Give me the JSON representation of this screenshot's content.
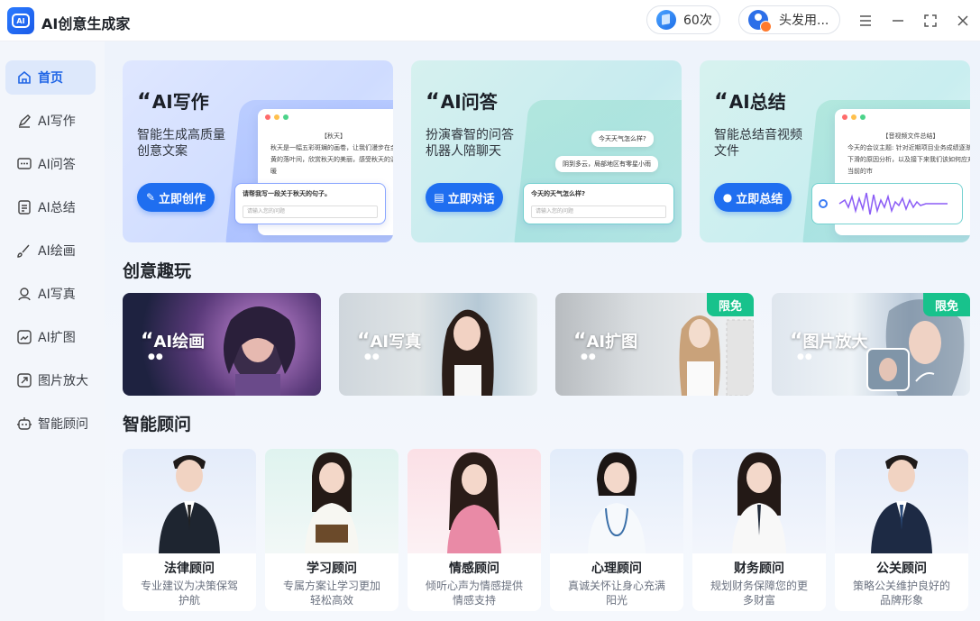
{
  "app": {
    "title": "AI创意生成家",
    "logo_text": "AI"
  },
  "header": {
    "credits": "60次",
    "user_name": "头发用..."
  },
  "sidebar": {
    "items": [
      {
        "label": "首页",
        "icon": "home-icon"
      },
      {
        "label": "AI写作",
        "icon": "pen-icon"
      },
      {
        "label": "AI问答",
        "icon": "chat-icon"
      },
      {
        "label": "AI总结",
        "icon": "document-icon"
      },
      {
        "label": "AI绘画",
        "icon": "brush-icon"
      },
      {
        "label": "AI写真",
        "icon": "portrait-icon"
      },
      {
        "label": "AI扩图",
        "icon": "expand-image-icon"
      },
      {
        "label": "图片放大",
        "icon": "enlarge-icon"
      },
      {
        "label": "智能顾问",
        "icon": "robot-icon"
      }
    ]
  },
  "features": [
    {
      "title": "AI写作",
      "desc": "智能生成高质量创意文案",
      "button": "立即创作",
      "mock_head": "【秋天】",
      "mock_text": "秋天是一幅五彩斑斓的画卷，让我们漫步在金黄的落叶间，欣赏秋天的美丽，感受秋天的温暖",
      "prompt": "请帮我写一段关于秋天的句子。",
      "placeholder": "请输入您的问题"
    },
    {
      "title": "AI问答",
      "desc": "扮演睿智的问答机器人陪聊天",
      "button": "立即对话",
      "bubble_q": "今天天气怎么样?",
      "bubble_a": "阴到多云，局部地区有零星小雨",
      "prompt": "今天的天气怎么样?",
      "placeholder": "请输入您的问题"
    },
    {
      "title": "AI总结",
      "desc": "智能总结音视频文件",
      "button": "立即总结",
      "mock_head": "【音视频文件总结】",
      "mock_text": "今天的会议主题: 针对近期项目业务成绩逐渐下滑的原因分析，以及接下来我们该如何应对当前的市"
    }
  ],
  "section_fun": {
    "title": "创意趣玩"
  },
  "fun_items": [
    {
      "label": "AI绘画",
      "badge": ""
    },
    {
      "label": "AI写真",
      "badge": ""
    },
    {
      "label": "AI扩图",
      "badge": "限免"
    },
    {
      "label": "图片放大",
      "badge": "限免"
    }
  ],
  "section_advisor": {
    "title": "智能顾问"
  },
  "advisors": [
    {
      "name": "法律顾问",
      "desc": "专业建议为决策保驾护航"
    },
    {
      "name": "学习顾问",
      "desc": "专属方案让学习更加轻松高效"
    },
    {
      "name": "情感顾问",
      "desc": "倾听心声为情感提供情感支持"
    },
    {
      "name": "心理顾问",
      "desc": "真诚关怀让身心充满阳光"
    },
    {
      "name": "财务顾问",
      "desc": "规划财务保障您的更多财富"
    },
    {
      "name": "公关顾问",
      "desc": "策略公关维护良好的品牌形象"
    }
  ],
  "colors": {
    "accent": "#1f6ef0",
    "badge": "#18c28c",
    "sidebar_active_bg": "#dde8fb"
  }
}
